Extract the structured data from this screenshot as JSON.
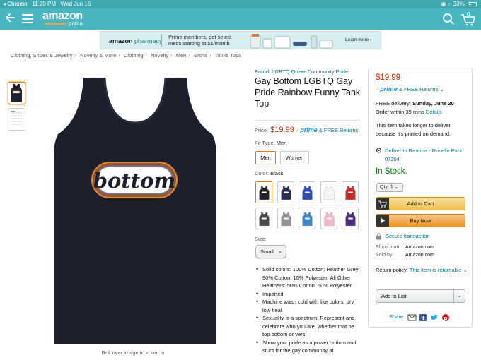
{
  "status_bar": {
    "back_app": "◂ Chrome",
    "time": "11:20 PM",
    "date": "Wed Jun 16",
    "battery": "33%"
  },
  "nav": {
    "logo": "amazon",
    "logo_sub": "prime",
    "cart_count": "0"
  },
  "banner": {
    "logo_bold": "amazon",
    "logo_rest": "pharmacy",
    "message": "Prime members, get select meds starting at $1/month",
    "cta": "Learn more ›"
  },
  "breadcrumb": [
    "Clothing, Shoes & Jewelry",
    "Novelty & More",
    "Clothing",
    "Novelty",
    "Men",
    "Shirts",
    "Tanks Tops"
  ],
  "product": {
    "brand": "Brand: LGBTQ Queer Community Pride",
    "title": "Gay Bottom LGBTQ Gay Pride Rainbow Funny Tank Top",
    "price_label": "Price:",
    "price": "$19.99",
    "prime": "prime",
    "free_returns": "& FREE Returns",
    "fit_label": "Fit Type:",
    "fit_value": "Men",
    "fit_options": [
      "Men",
      "Women"
    ],
    "color_label": "Color:",
    "color_value": "Black",
    "swatch_colors": [
      "#222222",
      "#2b2f55",
      "#2f4db1",
      "#f4f4f4",
      "#c62828",
      "#4a4a4a",
      "#8f9296",
      "#3e86c9",
      "#f3b6cf",
      "#4a2a7a"
    ],
    "size_label": "Size:",
    "size_value": "Small",
    "image_text": "bottom",
    "zoom_hint": "Roll over image to zoom in",
    "bullets": [
      "Solid colors: 100% Cotton; Heather Grey: 90% Cotton, 10% Polyester; All Other Heathers: 50% Cotton, 50% Polyester",
      "Imported",
      "Machine wash cold with like colors, dry low heat",
      "Sexuality is a spectrum! Represent and celebrate who you are, whether that be top bottom or vers!",
      "Show your pride as a power bottom and stunt for the gay community at"
    ]
  },
  "buybox": {
    "price": "$19.99",
    "prime": "prime",
    "free_returns": "& FREE Returns",
    "free_delivery_label": "FREE delivery:",
    "free_delivery_date": "Sunday, June 20",
    "order_within": "Order within 39 mins",
    "details": "Details",
    "print_note": "This item takes longer to deliver because it's printed on demand.",
    "deliver_to": "Deliver to Reanna - Roselle Park 07204",
    "stock": "In Stock.",
    "qty": "Qty: 1",
    "add_to_cart": "Add to Cart",
    "buy_now": "Buy Now",
    "secure": "Secure transaction",
    "ships_from_label": "Ships from",
    "ships_from": "Amazon.com",
    "sold_by_label": "Sold by",
    "sold_by": "Amazon.com",
    "return_label": "Return policy:",
    "return_link": "This item is returnable",
    "add_to_list": "Add to List",
    "share": "Share"
  }
}
